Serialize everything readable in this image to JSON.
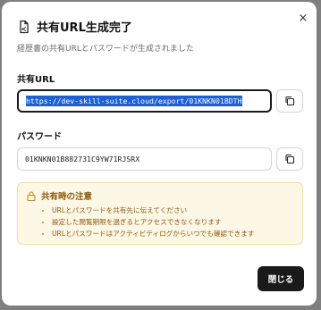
{
  "dialog": {
    "title": "共有URL生成完了",
    "subtitle": "経歴書の共有URLとパスワードが生成されました",
    "close_icon": "×",
    "icon_name": "document-share-icon"
  },
  "url_section": {
    "label": "共有URL",
    "value": "https://dev-skill-suite.cloud/export/01KNKN01BDTH",
    "copy_icon": "copy-icon"
  },
  "password_section": {
    "label": "パスワード",
    "value": "01KNKN01B882731C9YW71RJSRX",
    "copy_icon": "copy-icon"
  },
  "notice": {
    "title": "共有時の注意",
    "icon_name": "lock-icon",
    "items": [
      "URLとパスワードを共有先に伝えてください",
      "設定した閲覧期限を過ぎるとアクセスできなくなります",
      "URLとパスワードはアクティビティログからいつでも確認できます"
    ]
  },
  "footer": {
    "close_label": "閉じる"
  },
  "colors": {
    "overlay": "#7f7f7f",
    "primary_button": "#1a1a1a",
    "selection": "#1d5fd6",
    "notice_bg": "#fdf7e6",
    "notice_text": "#8a5a12"
  }
}
